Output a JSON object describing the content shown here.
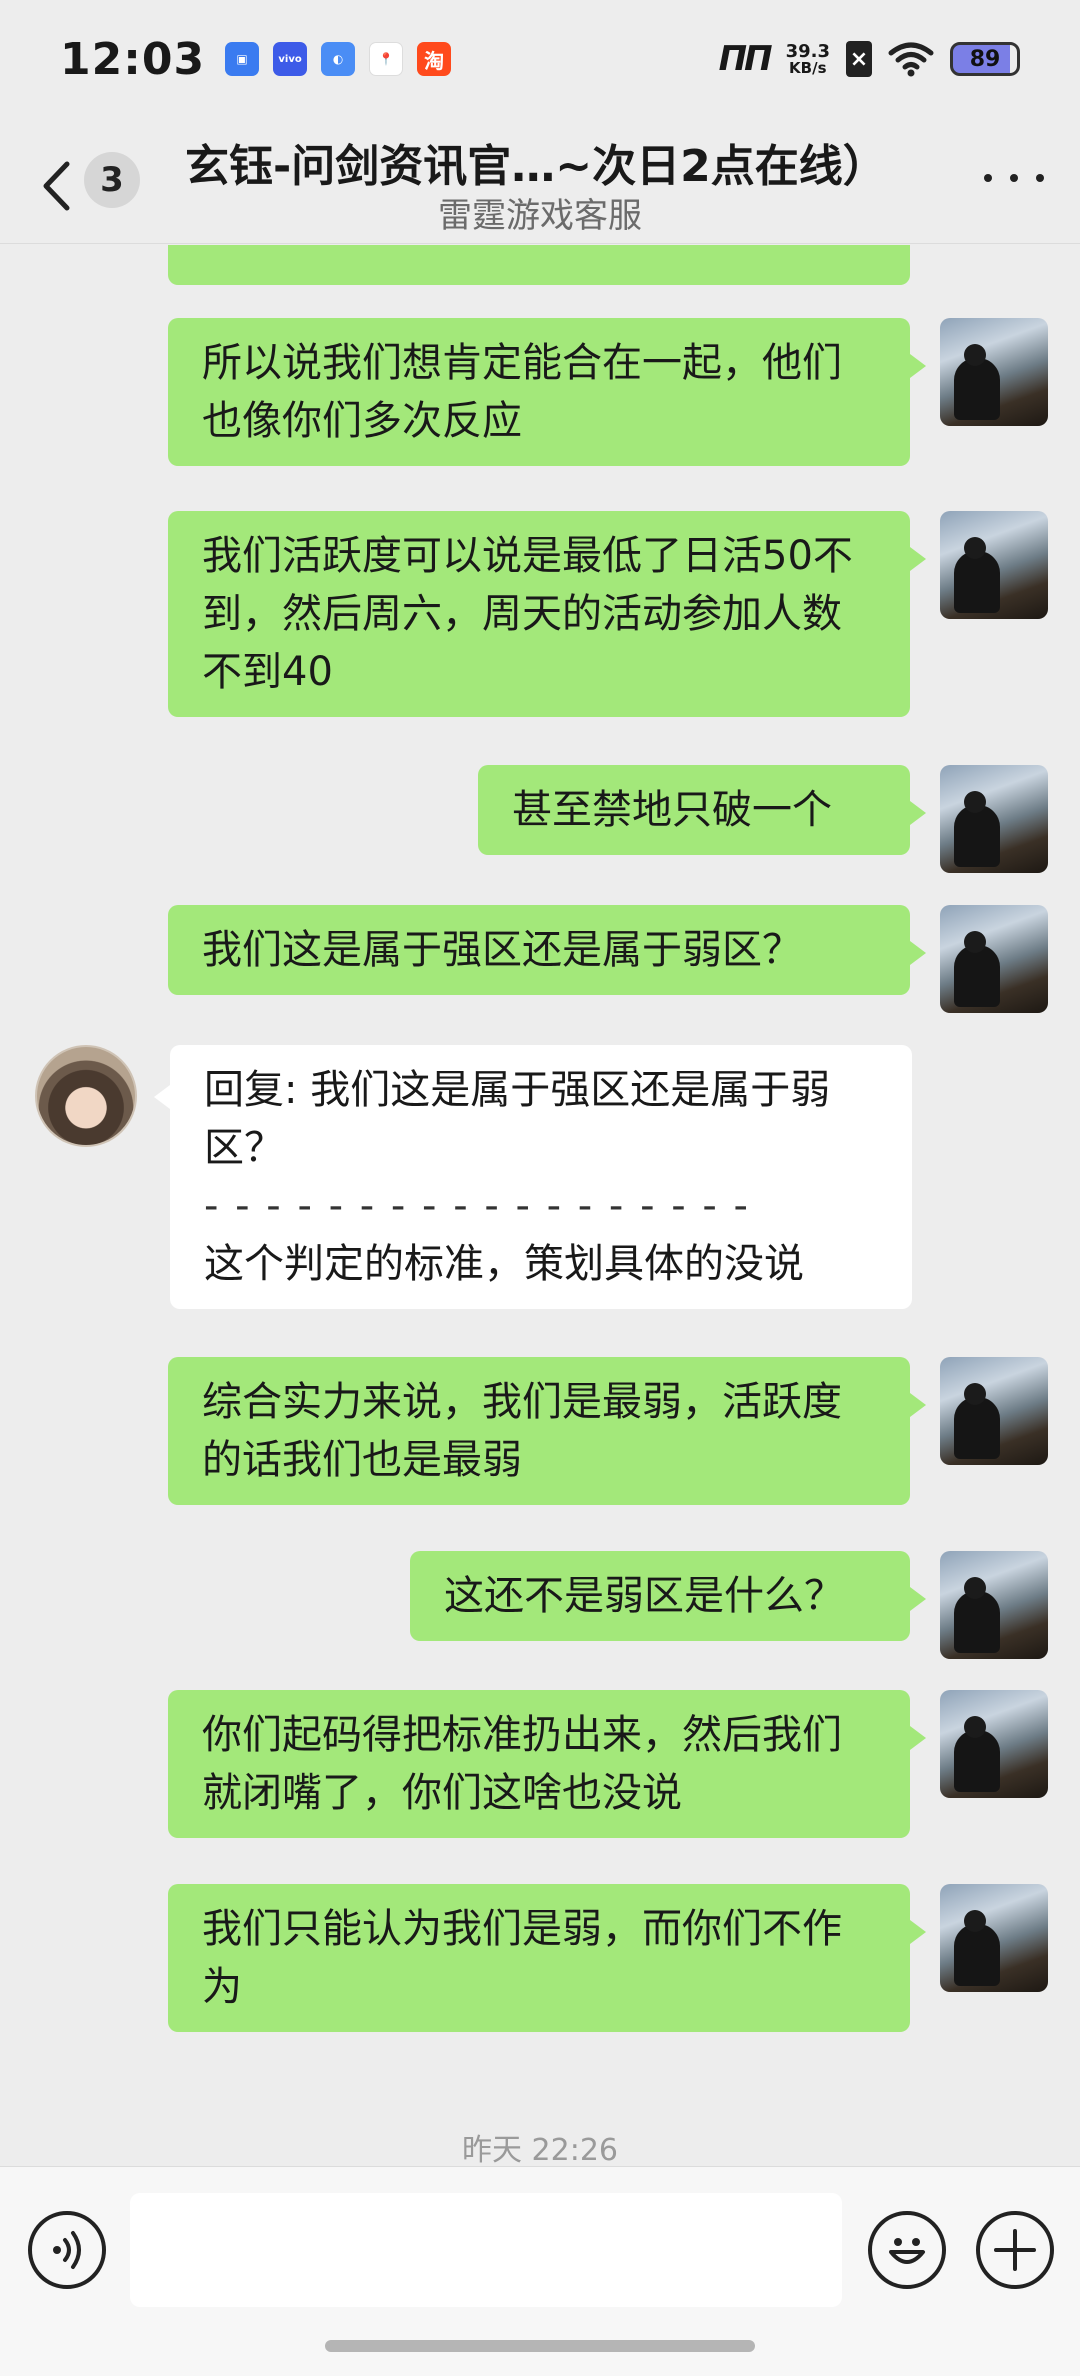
{
  "status_bar": {
    "time": "12:03",
    "net_speed_value": "39.3",
    "net_speed_unit": "KB/s",
    "battery": "89",
    "app_icons": [
      "screen-mirror-app-icon",
      "vivo-app-icon",
      "browser-app-icon",
      "map-app-icon",
      "taobao-app-icon"
    ],
    "taobao_label": "淘",
    "vivo_label": "vivo"
  },
  "header": {
    "unread_count": "3",
    "title": "玄钰-问剑资讯官…~次日2点在线）",
    "subtitle": "雷霆游戏客服"
  },
  "messages": [
    {
      "from": "me",
      "text": "所以说我们想肯定能合在一起，他们也像你们多次反应"
    },
    {
      "from": "me",
      "text": "我们活跃度可以说是最低了日活50不到，然后周六，周天的活动参加人数不到40"
    },
    {
      "from": "me",
      "text": "甚至禁地只破一个"
    },
    {
      "from": "me",
      "text": "我们这是属于强区还是属于弱区？"
    },
    {
      "from": "other",
      "quote": "回复: 我们这是属于强区还是属于弱区？",
      "separator": "- - - - - - - - - - - - - - - - - -",
      "text": "这个判定的标准，策划具体的没说"
    },
    {
      "from": "me",
      "text": "综合实力来说，我们是最弱，活跃度的话我们也是最弱"
    },
    {
      "from": "me",
      "text": "这还不是弱区是什么？"
    },
    {
      "from": "me",
      "text": "你们起码得把标准扔出来，然后我们就闭嘴了，你们这啥也没说"
    },
    {
      "from": "me",
      "text": "我们只能认为我们是弱，而你们不作为"
    }
  ],
  "timestamp": "昨天 22:26",
  "input": {
    "placeholder": ""
  },
  "colors": {
    "my_bubble": "#a3e87a",
    "other_bubble": "#ffffff",
    "background": "#ededed"
  }
}
